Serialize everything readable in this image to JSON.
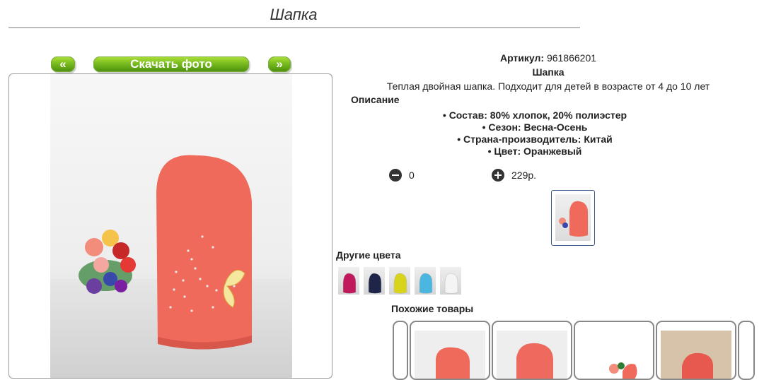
{
  "page": {
    "title": "Шапка"
  },
  "gallery": {
    "prev_label": "«",
    "download_label": "Скачать фото",
    "next_label": "»"
  },
  "product": {
    "article_label": "Артикул:",
    "article_value": "961866201",
    "name": "Шапка",
    "description": "Теплая двойная шапка. Подходит для детей в возрасте от 4 до 10 лет",
    "description_heading": "Описание",
    "specs": [
      "Состав: 80% хлопок, 20% полиэстер",
      "Сезон: Весна-Осень",
      "Страна-производитель: Китай",
      "Цвет: Оранжевый"
    ],
    "quantity": "0",
    "price": "229р.",
    "colors": {
      "hat": "#f06a5c",
      "accent": "#6fb31a"
    }
  },
  "other_colors": {
    "heading": "Другие цвета",
    "items": [
      {
        "name": "crimson",
        "hex": "#c0185a"
      },
      {
        "name": "navy",
        "hex": "#1f2548"
      },
      {
        "name": "yellow",
        "hex": "#d8d41c"
      },
      {
        "name": "sky-blue",
        "hex": "#4bb6e0"
      },
      {
        "name": "white",
        "hex": "#f4f4f4"
      }
    ]
  },
  "similar": {
    "heading": "Похожие товары"
  }
}
